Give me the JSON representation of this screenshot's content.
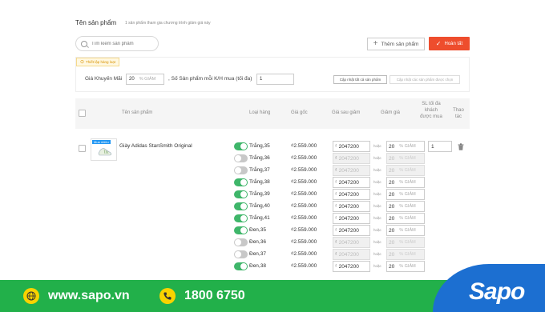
{
  "section": {
    "title": "Tên sản phẩm",
    "subtitle": "1 sản phẩm tham gia chương trình giảm giá này"
  },
  "search": {
    "placeholder": "Tìm kiếm sản phẩm"
  },
  "toolbar": {
    "add_label": "Thêm sản phẩm",
    "done_label": "Hoàn tất"
  },
  "config": {
    "tag": "Thiết lập hàng loạt",
    "promo_label": "Giá Khuyến Mãi",
    "promo_value": "20",
    "promo_unit": "% GIẢM",
    "limit_label": ", Số Sản phẩm mỗi K/H mua (tối đa)",
    "limit_value": "1",
    "update_all": "Cập nhật tất cả sản phẩm",
    "update_selected": "Cập nhật các sản phẩm được chọn"
  },
  "table": {
    "headers": {
      "product": "Tên sản phẩm",
      "type": "Loại hàng",
      "original": "Giá gốc",
      "after": "Giá sau giảm",
      "discount": "Giảm giá",
      "limit": "SL tối đa khách được mua",
      "action": "Thao tác"
    }
  },
  "product": {
    "name": "Giày Adidas StanSmith Original",
    "thumb_tag": "Mua nhiều",
    "limit_value": "1"
  },
  "variants": [
    {
      "name": "Trắng,35",
      "price": "₫2.559.000",
      "after": "2047200",
      "discount": "20",
      "on": true
    },
    {
      "name": "Trắng,36",
      "price": "₫2.559.000",
      "after": "2047200",
      "discount": "20",
      "on": false
    },
    {
      "name": "Trắng,37",
      "price": "₫2.559.000",
      "after": "2047200",
      "discount": "20",
      "on": false
    },
    {
      "name": "Trắng,38",
      "price": "₫2.559.000",
      "after": "2047200",
      "discount": "20",
      "on": true
    },
    {
      "name": "Trắng,39",
      "price": "₫2.559.000",
      "after": "2047200",
      "discount": "20",
      "on": true
    },
    {
      "name": "Trắng,40",
      "price": "₫2.559.000",
      "after": "2047200",
      "discount": "20",
      "on": true
    },
    {
      "name": "Trắng,41",
      "price": "₫2.559.000",
      "after": "2047200",
      "discount": "20",
      "on": true
    },
    {
      "name": "Đen,35",
      "price": "₫2.559.000",
      "after": "2047200",
      "discount": "20",
      "on": true
    },
    {
      "name": "Đen,36",
      "price": "₫2.559.000",
      "after": "2047200",
      "discount": "20",
      "on": false
    },
    {
      "name": "Đen,37",
      "price": "₫2.559.000",
      "after": "2047200",
      "discount": "20",
      "on": false
    },
    {
      "name": "Đen,38",
      "price": "₫2.559.000",
      "after": "2047200",
      "discount": "20",
      "on": true
    }
  ],
  "row_labels": {
    "currency": "₫",
    "or": "hoặc",
    "discount_unit": "% GIẢM"
  },
  "footer": {
    "url": "www.sapo.vn",
    "phone": "1800 6750",
    "logo": "Sapo",
    "green": "#22b04a",
    "blue": "#1c6fd1",
    "icon_yellow": "#f9d300"
  },
  "colors": {
    "accent": "#ee4d2d",
    "toggle_on": "#3fb66a",
    "toggle_off": "#c8c8c8"
  },
  "icons": [
    "search-icon",
    "plus-icon",
    "check-icon",
    "warning-icon",
    "trash-icon",
    "globe-icon",
    "phone-icon"
  ]
}
